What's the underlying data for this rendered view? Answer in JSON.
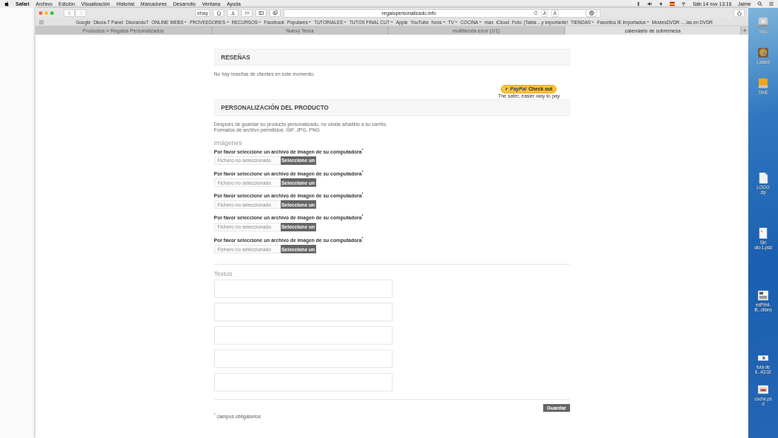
{
  "menu_bar": {
    "items": [
      {
        "label": "Safari",
        "kind": "app"
      },
      {
        "label": "Archivo",
        "kind": "menu"
      },
      {
        "label": "Edición",
        "kind": "menu"
      },
      {
        "label": "Visualización",
        "kind": "menu"
      },
      {
        "label": "Historial",
        "kind": "menu"
      },
      {
        "label": "Marcadores",
        "kind": "menu"
      },
      {
        "label": "Desarrollo",
        "kind": "menu"
      },
      {
        "label": "Ventana",
        "kind": "menu"
      },
      {
        "label": "Ayuda",
        "kind": "menu"
      }
    ],
    "clock": "Sáb 14 nov 13:16",
    "user": "Jaime"
  },
  "browser": {
    "toolbar": {
      "ebay_button": "ebay",
      "address": "regalopersonalizado.info",
      "font_smaller": "A",
      "font_larger": "A"
    },
    "bookmarks": [
      {
        "label": "Google",
        "menu": false
      },
      {
        "label": "Dkora-T Panel",
        "menu": false
      },
      {
        "label": "DkorandoT",
        "menu": false
      },
      {
        "label": "ONLINE WEBS",
        "menu": true
      },
      {
        "label": "PROVEEDORES",
        "menu": true
      },
      {
        "label": "RECURSOS",
        "menu": true
      },
      {
        "label": "Facebook",
        "menu": false
      },
      {
        "label": "Populares",
        "menu": true
      },
      {
        "label": "TUTORIALES",
        "menu": true
      },
      {
        "label": "TUTOS FINAL CUT",
        "menu": true
      },
      {
        "label": "Apple",
        "menu": false
      },
      {
        "label": "YouTube",
        "menu": false
      },
      {
        "label": "foros",
        "menu": true
      },
      {
        "label": "TV",
        "menu": true
      },
      {
        "label": "COCINA",
        "menu": true
      },
      {
        "label": "max",
        "menu": false
      },
      {
        "label": "iCloud",
        "menu": false
      },
      {
        "label": "Foto: (Tabla ...y importante!",
        "menu": false
      },
      {
        "label": "TIENDAS",
        "menu": true
      },
      {
        "label": "Favoritos IE importados",
        "menu": true
      },
      {
        "label": "MoviesDVDR -...las en DVDR",
        "menu": false
      }
    ],
    "tabs": [
      {
        "label": "Productos » Regalos Personalizados",
        "selected": false
      },
      {
        "label": "Nuevo Tema",
        "selected": false
      },
      {
        "label": "multitienda error (1/1)",
        "selected": false
      },
      {
        "label": "calendario de sobremesa",
        "selected": true
      }
    ]
  },
  "page": {
    "reviews": {
      "title": "RESEÑAS",
      "empty_text": "No hay reseñas de clientes en este momento."
    },
    "paypal": {
      "brand": "PayPal",
      "action": "Check out",
      "tagline": "The safer, easier way to pay"
    },
    "personalization": {
      "title": "PERSONALIZACIÓN DEL PRODUCTO",
      "notes": [
        "Después de guardar su producto personalizado, no olvide añadirlo a su carrito.",
        "Formatos de archivo permitidos: GIF, JPG, PNG"
      ],
      "images_heading": "Imágenes",
      "image_fields": [
        {
          "label": "Por favor seleccione un archivo de imagen de su computadora$^{*}$",
          "placeholder": "Fichero no seleccionado",
          "button": "Seleccione un"
        },
        {
          "label": "Por favor seleccione un archivo de imagen de su computadora$^{*}$",
          "placeholder": "Fichero no seleccionado",
          "button": "Seleccione un"
        },
        {
          "label": "Por favor seleccione un archivo de imagen de su computadora$^{*}$",
          "placeholder": "Fichero no seleccionado",
          "button": "Seleccione un"
        },
        {
          "label": "Por favor seleccione un archivo de imagen de su computadora$^{*}$",
          "placeholder": "Fichero no seleccionado",
          "button": "Seleccione un"
        },
        {
          "label": "Por favor seleccione un archivo de imagen de su computadora$^{*}$",
          "placeholder": "Fichero no seleccionado",
          "button": "Seleccione un"
        }
      ],
      "texts_heading": "Textos",
      "text_fields": [
        {
          "kind": "textarea"
        },
        {
          "kind": "textarea"
        },
        {
          "kind": "textarea"
        },
        {
          "kind": "textarea"
        },
        {
          "kind": "textarea"
        }
      ],
      "save_button": "Guardar",
      "footnote": "$^{*}$ campos obligatorios"
    }
  },
  "desktop_icons": [
    {
      "kind": "drive",
      "lines": [
        "Mac"
      ]
    },
    {
      "kind": "app",
      "lines": [
        "Lasted"
      ]
    },
    {
      "kind": "disk",
      "lines": [
        "TimE"
      ]
    },
    {
      "kind": "archive",
      "lines": [
        "LOGO",
        "zip"
      ]
    },
    {
      "kind": "document",
      "lines": [
        "Sin",
        "ulo-1.psd"
      ]
    },
    {
      "kind": "screenshot",
      "lines": [
        "esPrint-",
        "ilt...ctions"
      ]
    },
    {
      "kind": "small",
      "lines": [
        "tura de",
        "li...43.02"
      ]
    },
    {
      "kind": "photo",
      "lines": [
        "coche.ps",
        "d"
      ]
    }
  ]
}
